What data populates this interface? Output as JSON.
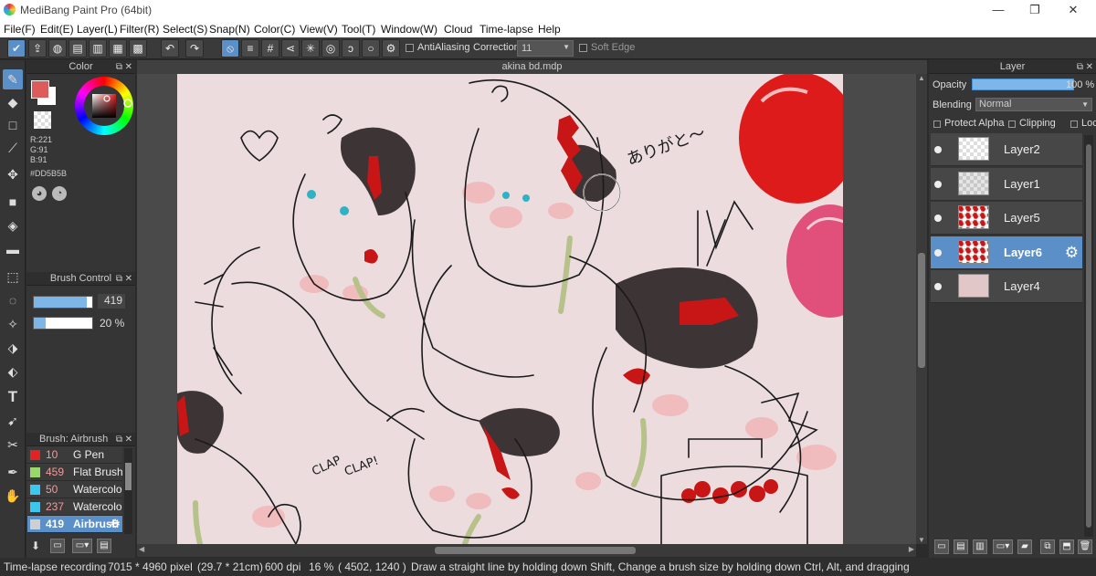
{
  "window": {
    "title": "MediBang Paint Pro (64bit)",
    "minimize": "—",
    "maximize": "❐",
    "close": "✕"
  },
  "menu": [
    "File(F)",
    "Edit(E)",
    "Layer(L)",
    "Filter(R)",
    "Select(S)",
    "Snap(N)",
    "Color(C)",
    "View(V)",
    "Tool(T)",
    "Window(W)",
    "Cloud",
    "Time-lapse",
    "Help"
  ],
  "toolbar": {
    "antialiasing_label": "AntiAliasing",
    "correction_label": "Correction",
    "correction_value": "11",
    "soft_edge_label": "Soft Edge"
  },
  "color_panel": {
    "title": "Color",
    "fg_color": "#DD5B5B",
    "r": "R:221",
    "g": "G:91",
    "b": "B:91",
    "hex": "#DD5B5B"
  },
  "brush_control": {
    "title": "Brush Control",
    "size": "419",
    "opacity": "20 %",
    "opacity_fraction": 0.2,
    "size_fraction": 0.9
  },
  "brush_panel": {
    "title": "Brush: Airbrush",
    "items": [
      {
        "color": "#e02424",
        "size": "10",
        "name": "G Pen",
        "selected": false
      },
      {
        "color": "#9bd86b",
        "size": "459",
        "name": "Flat Brush",
        "selected": false
      },
      {
        "color": "#3bc8f0",
        "size": "50",
        "name": "Watercolor",
        "selected": false
      },
      {
        "color": "#3bc8f0",
        "size": "237",
        "name": "Watercolor",
        "selected": false
      },
      {
        "color": "#cfcfcf",
        "size": "419",
        "name": "Airbrush",
        "selected": true
      }
    ]
  },
  "canvas": {
    "filename": "akina bd.mdp",
    "texts": [
      "ありがと～",
      "CLAP",
      "CLAP!"
    ]
  },
  "layer_panel": {
    "title": "Layer",
    "opacity_label": "Opacity",
    "opacity_value": "100 %",
    "blending_label": "Blending",
    "blending_value": "Normal",
    "protect_alpha": "Protect Alpha",
    "clipping": "Clipping",
    "lock": "Lock",
    "layers": [
      {
        "name": "Layer2",
        "selected": false
      },
      {
        "name": "Layer1",
        "selected": false
      },
      {
        "name": "Layer5",
        "selected": false
      },
      {
        "name": "Layer6",
        "selected": true
      },
      {
        "name": "Layer4",
        "selected": false
      }
    ]
  },
  "status": {
    "mode": "Time-lapse recording",
    "pixels": "7015 * 4960 pixel",
    "physical": "(29.7 * 21cm)",
    "dpi": "600 dpi",
    "zoom": "16 %",
    "coords": "( 4502, 1240 )",
    "hint": "Draw a straight line by holding down Shift, Change a brush size by holding down Ctrl, Alt, and dragging"
  }
}
